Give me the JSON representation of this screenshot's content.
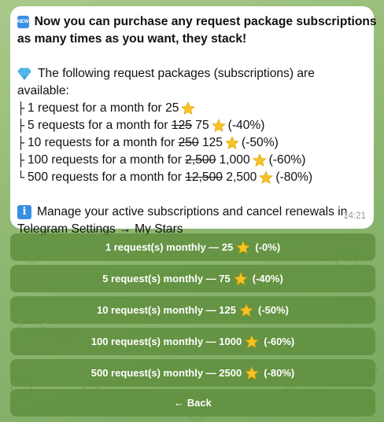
{
  "message": {
    "headline_badge": "NEW",
    "headline_line1": "Now you can purchase any request package subscriptions",
    "headline_line2": "as many times as you want, they stack!",
    "intro_line1": "The following request packages (subscriptions) are",
    "intro_line2": "available:",
    "packages": [
      {
        "tree": "├",
        "text": "1 request for a month for",
        "old": "",
        "price": "25",
        "discount": ""
      },
      {
        "tree": "├",
        "text": "5 requests for a month for",
        "old": "125",
        "price": "75",
        "discount": "(-40%)"
      },
      {
        "tree": "├",
        "text": "10 requests for a month for",
        "old": "250",
        "price": "125",
        "discount": "(-50%)"
      },
      {
        "tree": "├",
        "text": "100 requests for a month for",
        "old": "2,500",
        "price": "1,000",
        "discount": "(-60%)"
      },
      {
        "tree": "└",
        "text": "500 requests for a month for",
        "old": "12,500",
        "price": "2,500",
        "discount": "(-80%)"
      }
    ],
    "info_badge": "i",
    "footer_line1": "Manage your active subscriptions and cancel renewals in",
    "footer_line2": "Telegram Settings → My Stars",
    "time": "14:21"
  },
  "buttons": [
    {
      "label": "1 request(s) monthly — 25",
      "suffix": "(-0%)"
    },
    {
      "label": "5 request(s) monthly — 75",
      "suffix": "(-40%)"
    },
    {
      "label": "10 request(s) monthly — 125",
      "suffix": "(-50%)"
    },
    {
      "label": "100 request(s) monthly — 1000",
      "suffix": "(-60%)"
    },
    {
      "label": "500 request(s) monthly — 2500",
      "suffix": "(-80%)"
    }
  ],
  "back_label": "← Back",
  "colors": {
    "bubble": "#ffffff",
    "button": "#5c8c3a",
    "badge": "#3a8fe4",
    "star": "#f7c325",
    "background": "#8fb872"
  },
  "icons": {
    "headline": "new-badge-icon",
    "intro": "gem-icon",
    "footer": "info-icon",
    "price": "star-icon"
  }
}
